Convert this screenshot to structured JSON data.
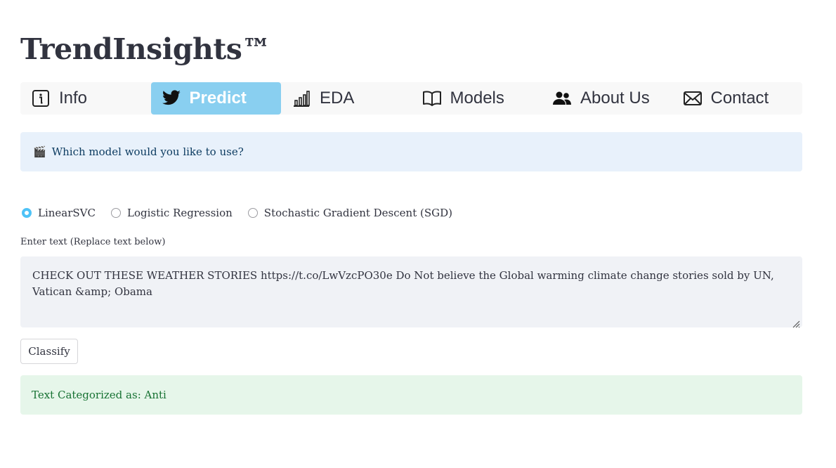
{
  "app": {
    "title": "TrendInsights™"
  },
  "nav": {
    "items": [
      {
        "label": "Info",
        "icon": "info-icon",
        "active": false
      },
      {
        "label": "Predict",
        "icon": "twitter-icon",
        "active": true
      },
      {
        "label": "EDA",
        "icon": "bar-chart-icon",
        "active": false
      },
      {
        "label": "Models",
        "icon": "book-icon",
        "active": false
      },
      {
        "label": "About Us",
        "icon": "people-icon",
        "active": false
      },
      {
        "label": "Contact",
        "icon": "envelope-icon",
        "active": false
      }
    ],
    "active_color": "#89cff0"
  },
  "info": {
    "icon": "🎬",
    "text": "Which model would you like to use?"
  },
  "model_options": {
    "selected": "LinearSVC",
    "options": [
      "LinearSVC",
      "Logistic Regression",
      "Stochastic Gradient Descent (SGD)"
    ]
  },
  "text_input": {
    "label": "Enter text (Replace text below)",
    "value": "CHECK OUT THESE WEATHER STORIES https://t.co/LwVzcPO30e Do Not believe the Global warming climate change stories sold by UN, Vatican &amp; Obama"
  },
  "classify_button": {
    "label": "Classify"
  },
  "result": {
    "text": "Text Categorized as: Anti"
  }
}
